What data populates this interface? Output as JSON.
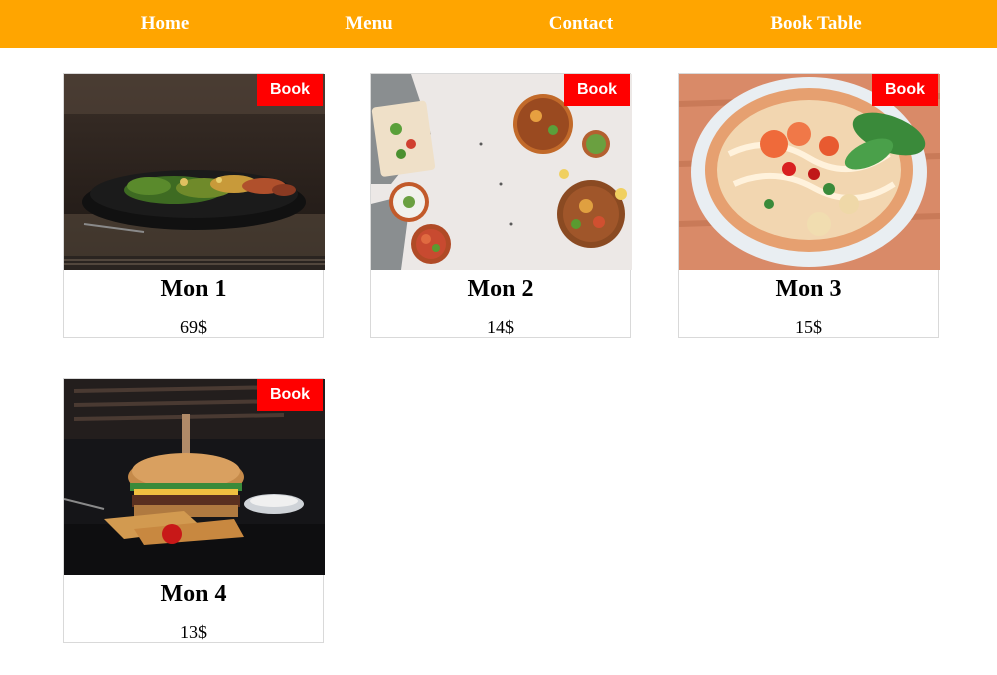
{
  "nav": {
    "home": "Home",
    "menu": "Menu",
    "contact": "Contact",
    "book_table": "Book Table"
  },
  "colors": {
    "nav_bg": "#ffa500",
    "book_button_bg": "#ff0000"
  },
  "dishes": [
    {
      "name": "Mon 1",
      "price": "69$",
      "book_label": "Book",
      "image": "salad-bowl-photo"
    },
    {
      "name": "Mon 2",
      "price": "14$",
      "book_label": "Book",
      "image": "food-spread-photo"
    },
    {
      "name": "Mon 3",
      "price": "15$",
      "book_label": "Book",
      "image": "noodle-soup-photo"
    },
    {
      "name": "Mon 4",
      "price": "13$",
      "book_label": "Book",
      "image": "burger-photo"
    }
  ]
}
